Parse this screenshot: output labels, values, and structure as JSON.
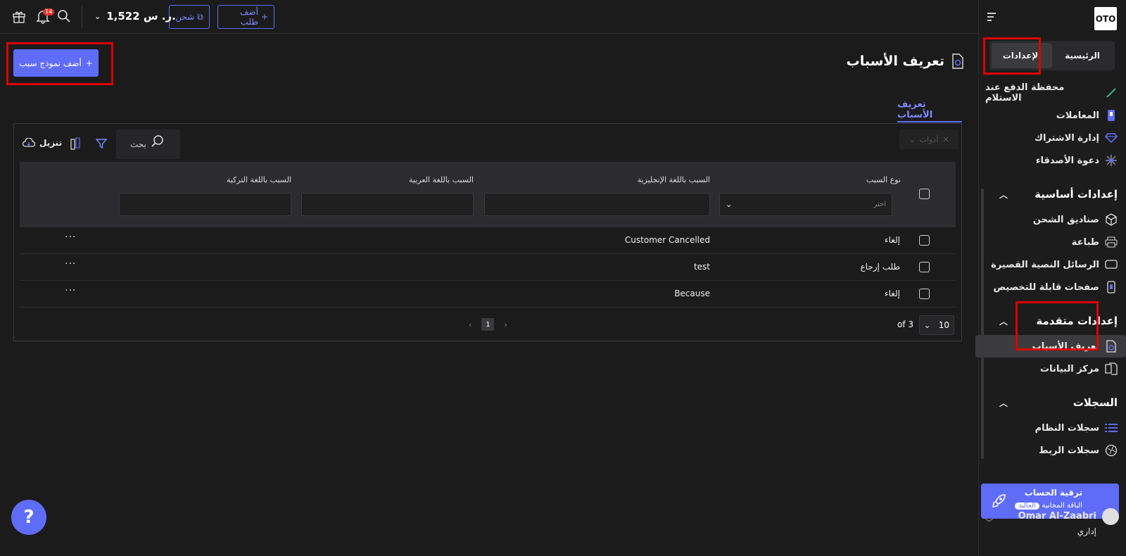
{
  "sidebar": {
    "logo": "OTO",
    "tabs": {
      "home": "الرئيسية",
      "settings": "الإعدادات"
    },
    "top_items": [
      {
        "label": "محفظة الدفع عند الاستلام",
        "icon": "wallet-icon"
      },
      {
        "label": "المعاملات",
        "icon": "transactions-icon"
      },
      {
        "label": "إدارة الاشتراك",
        "icon": "diamond-icon"
      },
      {
        "label": "دعوة الأصدقاء",
        "icon": "network-icon"
      }
    ],
    "sections": {
      "basic": "إعدادات أساسية",
      "advanced": "إعدادات متقدمة",
      "logs": "السجلات"
    },
    "basic_items": [
      {
        "label": "صناديق الشحن",
        "icon": "box-icon"
      },
      {
        "label": "طباعة",
        "icon": "printer-icon"
      },
      {
        "label": "الرسائل النصية القصيرة",
        "icon": "sms-icon"
      },
      {
        "label": "صفحات قابلة للتخصيص",
        "icon": "phone-icon"
      }
    ],
    "advanced_items": [
      {
        "label": "تعريف الأسباب",
        "icon": "settings-doc-icon"
      },
      {
        "label": "مركز البيانات",
        "icon": "documents-icon"
      }
    ],
    "log_items": [
      {
        "label": "سجلات النظام",
        "icon": "list-icon"
      },
      {
        "label": "سجلات الربط",
        "icon": "globe-icon"
      }
    ],
    "upgrade": {
      "title": "ترقية الحساب",
      "plan": "الباقة المجانية",
      "badge": "الحالية"
    },
    "user": {
      "name": "Omar Al-Zaabri",
      "role": "إداري"
    }
  },
  "topbar": {
    "add_order": "أضف طلب",
    "ship": "شحن",
    "balance": "1,522 ر. س.",
    "notification_count": "14"
  },
  "page": {
    "title": "تعريف الأسباب",
    "add_button": "أضف نموذج سبب",
    "tab": "تعريف الأسباب"
  },
  "table": {
    "tools_label": "أدوات",
    "search_placeholder": "بحث",
    "download_label": "تنزيل",
    "columns": {
      "type": "نوع السبب",
      "english": "السبب باللغة الإنجليزية",
      "arabic": "السبب باللغة العربية",
      "turkish": "السبب باللغة التركية"
    },
    "type_filter_placeholder": "اختر",
    "rows": [
      {
        "type": "إلغاء",
        "english": "Customer Cancelled"
      },
      {
        "type": "طلب إرجاع",
        "english": "test"
      },
      {
        "type": "إلغاء",
        "english": "Because"
      }
    ],
    "more": "···",
    "current_page": "1",
    "per_page": "10",
    "of_count": "of 3"
  },
  "help": "?",
  "colors": {
    "accent": "#5f6cf7",
    "highlight": "#e00000",
    "background": "#1b1b1c"
  }
}
